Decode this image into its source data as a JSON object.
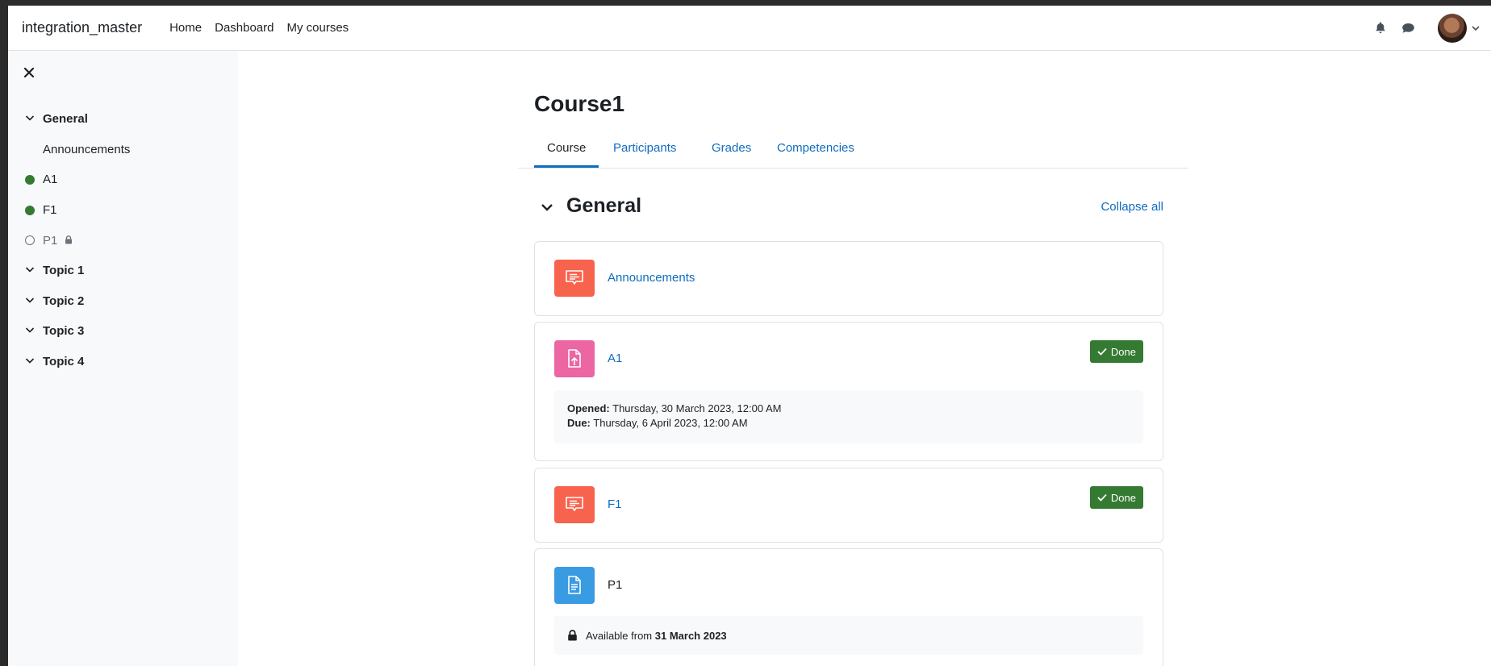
{
  "navbar": {
    "brand": "integration_master",
    "links": [
      "Home",
      "Dashboard",
      "My courses"
    ]
  },
  "course_index": {
    "items": [
      {
        "label": "General",
        "kind": "section"
      },
      {
        "label": "Announcements",
        "kind": "activity"
      },
      {
        "label": "A1",
        "kind": "activity",
        "completion": "done"
      },
      {
        "label": "F1",
        "kind": "activity",
        "completion": "done"
      },
      {
        "label": "P1",
        "kind": "activity",
        "completion": "none",
        "locked": true
      },
      {
        "label": "Topic 1",
        "kind": "section"
      },
      {
        "label": "Topic 2",
        "kind": "section"
      },
      {
        "label": "Topic 3",
        "kind": "section"
      },
      {
        "label": "Topic 4",
        "kind": "section"
      }
    ]
  },
  "course": {
    "title": "Course1",
    "tabs": [
      "Course",
      "Participants",
      "Grades",
      "Competencies"
    ],
    "active_tab": "Course"
  },
  "section": {
    "title": "General",
    "collapse_all": "Collapse all"
  },
  "activities": {
    "announcements": {
      "name": "Announcements",
      "icon": "forum-icon",
      "color": "#f7634d"
    },
    "a1": {
      "name": "A1",
      "icon": "assignment-icon",
      "color": "#eb66a2",
      "badge": "Done",
      "opened_label": "Opened:",
      "opened_value": "Thursday, 30 March 2023, 12:00 AM",
      "due_label": "Due:",
      "due_value": "Thursday, 6 April 2023, 12:00 AM"
    },
    "f1": {
      "name": "F1",
      "icon": "forum-icon",
      "color": "#f7634d",
      "badge": "Done"
    },
    "p1": {
      "name": "P1",
      "icon": "page-icon",
      "color": "#399be2",
      "avail_prefix": "Available from",
      "avail_date": "31 March 2023"
    }
  },
  "colors": {
    "link": "#0f6cbf",
    "done": "#357a32",
    "completion_dot": "#357a32"
  }
}
